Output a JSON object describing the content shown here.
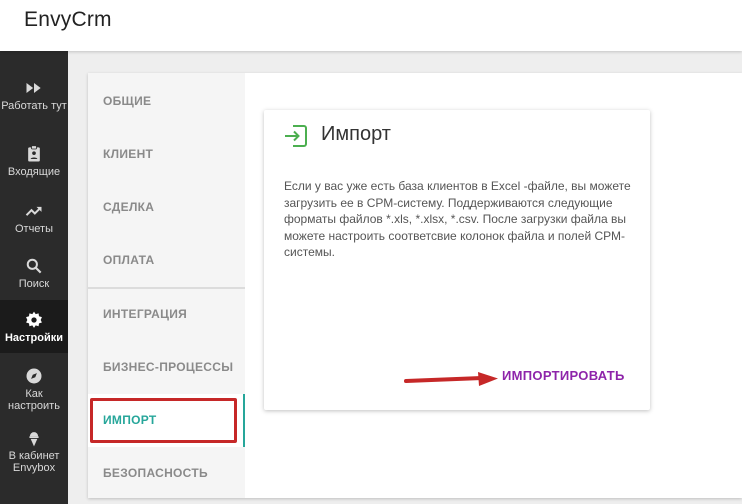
{
  "app": {
    "title": "EnvyCrm"
  },
  "sidebar": {
    "items": [
      {
        "label": "Работать тут",
        "icon": "fast-forward-icon"
      },
      {
        "label": "Входящие",
        "icon": "clipboard-icon"
      },
      {
        "label": "Отчеты",
        "icon": "trending-up-icon"
      },
      {
        "label": "Поиск",
        "icon": "search-icon"
      },
      {
        "label": "Настройки",
        "icon": "gear-icon",
        "active": true
      },
      {
        "label": "Как настроить",
        "icon": "compass-icon"
      },
      {
        "label": "В кабинет Envybox",
        "icon": "ice-cream-icon"
      }
    ]
  },
  "settings_menu": {
    "items": [
      {
        "label": "ОБЩИЕ"
      },
      {
        "label": "КЛИЕНТ"
      },
      {
        "label": "СДЕЛКА"
      },
      {
        "label": "ОПЛАТА"
      },
      {
        "label": "ИНТЕГРАЦИЯ"
      },
      {
        "label": "БИЗНЕС-ПРОЦЕССЫ"
      },
      {
        "label": "ИМПОРТ",
        "active": true
      },
      {
        "label": "БЕЗОПАСНОСТЬ"
      }
    ]
  },
  "card": {
    "title": "Импорт",
    "icon": "import-icon",
    "description": "Если у вас уже есть база клиентов в Excel -файле, вы можете загрузить ее в СРМ-систему. Поддерживаются следующие форматы файлов *.xls, *.xlsx, *.csv. После загрузки файла вы можете настроить соответсвие колонок файла и полей СРМ-системы.",
    "action_label": "ИМПОРТИРОВАТЬ"
  },
  "colors": {
    "sidebar_bg": "#2b2b2b",
    "accent_teal": "#26a69a",
    "action_purple": "#8e24aa",
    "annotation_red": "#c62828",
    "icon_green": "#4caf50"
  }
}
